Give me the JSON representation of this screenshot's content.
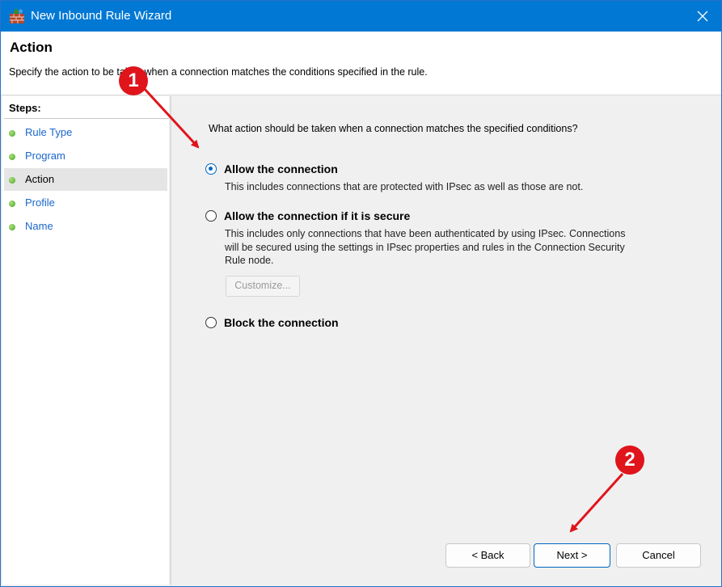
{
  "window": {
    "title": "New Inbound Rule Wizard",
    "close_icon": "close-icon",
    "app_icon": "firewall-icon"
  },
  "header": {
    "title": "Action",
    "description": "Specify the action to be taken when a connection matches the conditions specified in the rule."
  },
  "steps": {
    "title": "Steps:",
    "items": [
      {
        "label": "Rule Type",
        "active": false
      },
      {
        "label": "Program",
        "active": false
      },
      {
        "label": "Action",
        "active": true
      },
      {
        "label": "Profile",
        "active": false
      },
      {
        "label": "Name",
        "active": false
      }
    ]
  },
  "content": {
    "question": "What action should be taken when a connection matches the specified conditions?",
    "options": [
      {
        "label": "Allow the connection",
        "description": "This includes connections that are protected with IPsec as well as those are not.",
        "selected": true
      },
      {
        "label": "Allow the connection if it is secure",
        "description_lines": [
          "This includes only connections that have been authenticated by using IPsec.  Connections",
          "will be secured using the settings in IPsec properties and rules in the Connection Security",
          "Rule node."
        ],
        "selected": false
      },
      {
        "label": "Block the connection",
        "selected": false
      }
    ],
    "customize_label": "Customize..."
  },
  "buttons": {
    "back": "< Back",
    "next": "Next >",
    "cancel": "Cancel"
  },
  "annotations": {
    "marker1": "1",
    "marker2": "2"
  },
  "colors": {
    "titlebar": "#0078d4",
    "link": "#1a66cc",
    "annotation": "#e0141b"
  }
}
